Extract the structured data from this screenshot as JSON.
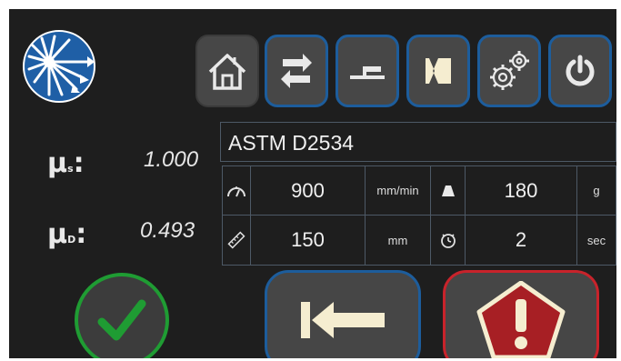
{
  "toolbar": {
    "buttons": [
      {
        "id": "home",
        "icon": "home-icon"
      },
      {
        "id": "swap",
        "icon": "swap-arrows-icon"
      },
      {
        "id": "sled",
        "icon": "sled-icon"
      },
      {
        "id": "plane",
        "icon": "plane-icon"
      },
      {
        "id": "settings",
        "icon": "gears-icon"
      },
      {
        "id": "power",
        "icon": "power-icon"
      }
    ]
  },
  "results": {
    "static_symbol": "μ",
    "static_sub": "s",
    "static_value": "1.000",
    "kinetic_symbol": "μ",
    "kinetic_sub": "D",
    "kinetic_value": "0.493",
    "colon": ":"
  },
  "method": {
    "name": "ASTM D2534"
  },
  "parameters": {
    "speed": {
      "icon": "speedometer-icon",
      "value": "900",
      "unit": "mm/min"
    },
    "weight": {
      "icon": "weight-icon",
      "value": "180",
      "unit": "g"
    },
    "length": {
      "icon": "ruler-icon",
      "value": "150",
      "unit": "mm"
    },
    "delay": {
      "icon": "clock-icon",
      "value": "2",
      "unit": "sec"
    }
  },
  "actions": {
    "ok": {
      "icon": "checkmark-icon"
    },
    "back": {
      "icon": "arrow-to-start-icon"
    },
    "stop": {
      "icon": "warning-pentagon-icon"
    }
  },
  "colors": {
    "background": "#1e1e1e",
    "button": "#474747",
    "accent_blue": "#1d5d9c",
    "ok_green": "#1f9c33",
    "stop_red": "#c8232b",
    "cream": "#f5edd0"
  }
}
